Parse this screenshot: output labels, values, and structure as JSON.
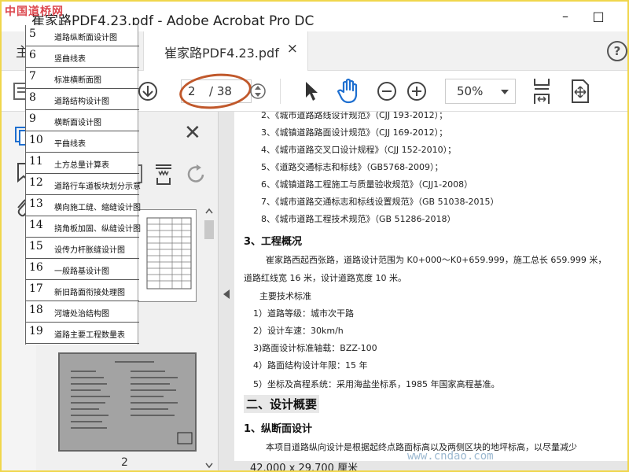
{
  "window": {
    "title": "崔家路PDF4.23.pdf - Adobe Acrobat Pro DC",
    "watermark_tl": "中国道桥网",
    "minimize": "–",
    "maximize": "□",
    "close": "✕"
  },
  "tabs": {
    "home_label": "主",
    "doc_title": "崔家路PDF4.23.pdf",
    "doc_close": "×",
    "help": "?"
  },
  "toolbar": {
    "page_current": "2",
    "page_total": "/ 38",
    "zoom": "50%"
  },
  "thumbnails": {
    "close": "✕",
    "page_label": "2"
  },
  "list_items": [
    {
      "num": "5",
      "name": "道路纵断面设计图"
    },
    {
      "num": "6",
      "name": "竖曲线表"
    },
    {
      "num": "7",
      "name": "标准横断面图"
    },
    {
      "num": "8",
      "name": "道路结构设计图"
    },
    {
      "num": "9",
      "name": "横断面设计图"
    },
    {
      "num": "10",
      "name": "平曲线表"
    },
    {
      "num": "11",
      "name": "土方总量计算表"
    },
    {
      "num": "12",
      "name": "道路行车道板块划分示意"
    },
    {
      "num": "13",
      "name": "横向施工缝、缩缝设计图"
    },
    {
      "num": "14",
      "name": "挠角板加固、纵缝设计图"
    },
    {
      "num": "15",
      "name": "设传力杆胀缝设计图"
    },
    {
      "num": "16",
      "name": "一般路基设计图"
    },
    {
      "num": "17",
      "name": "新旧路面衔接处理图"
    },
    {
      "num": "18",
      "name": "河塘处治结构图"
    },
    {
      "num": "19",
      "name": "道路主要工程数量表"
    }
  ],
  "document": {
    "ref_list": [
      "2、《城市道路路线设计规范》（CJJ 193-2012）；",
      "3、《城镇道路路面设计规范》（CJJ 169-2012）；",
      "4、《城市道路交叉口设计规程》（CJJ 152-2010）；",
      "5、《道路交通标志和标线》（GB5768-2009）；",
      "6、《城镇道路工程施工与质量验收规范》（CJJ1-2008）",
      "7、《城市道路交通标志和标线设置规范》（GB 51038-2015）",
      "8、《城市道路工程技术规范》（GB 51286-2018）"
    ],
    "section3_title": "3、工程概况",
    "section3_p1": "崔家路西起西张路，道路设计范围为 K0+000～K0+659.999，施工总长 659.999 米，",
    "section3_p2": "道路红线宽 16 米，设计道路宽度 10 米。",
    "tech_title": "主要技术标准",
    "tech_items": [
      "1）道路等级：城市次干路",
      "2）设计车速：30km/h",
      "3)路面设计标准轴载：BZZ-100",
      "4）路面结构设计年限：15 年",
      "5）坐标及高程系统：采用海盐坐标系，1985 年国家高程基准。"
    ],
    "chapter2_title": "二、设计概要",
    "sub1_title": "1、纵断面设计",
    "sub1_p1": "本项目道路纵向设计是根据起终点路面标高以及两侧区块的地坪标高，以尽量减少",
    "page_size": "42.000 x 29.700 厘米"
  },
  "watermark_br": "www.cndao.com"
}
